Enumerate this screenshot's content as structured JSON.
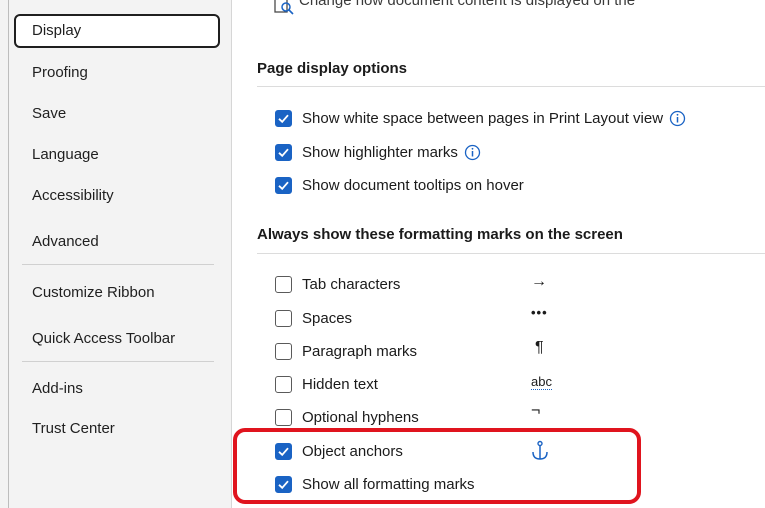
{
  "sidebar": {
    "items": [
      {
        "label": "Display"
      },
      {
        "label": "Proofing"
      },
      {
        "label": "Save"
      },
      {
        "label": "Language"
      },
      {
        "label": "Accessibility"
      },
      {
        "label": "Advanced"
      },
      {
        "label": "Customize Ribbon"
      },
      {
        "label": "Quick Access Toolbar"
      },
      {
        "label": "Add-ins"
      },
      {
        "label": "Trust Center"
      }
    ],
    "selected": "Display"
  },
  "header": {
    "clipped_text": "Change how document content is displayed on the"
  },
  "page_display": {
    "title": "Page display options",
    "options": [
      {
        "label": "Show white space between pages in Print Layout view",
        "checked": true,
        "info": true
      },
      {
        "label": "Show highlighter marks",
        "checked": true,
        "info": true
      },
      {
        "label": "Show document tooltips on hover",
        "checked": true,
        "info": false
      }
    ]
  },
  "formatting_marks": {
    "title": "Always show these formatting marks on the screen",
    "options": [
      {
        "label": "Tab characters",
        "checked": false,
        "symbol": "→"
      },
      {
        "label": "Spaces",
        "checked": false,
        "symbol": "•••"
      },
      {
        "label": "Paragraph marks",
        "checked": false,
        "symbol": "¶"
      },
      {
        "label": "Hidden text",
        "checked": false,
        "symbol": "abc"
      },
      {
        "label": "Optional hyphens",
        "checked": false,
        "symbol": "¬"
      },
      {
        "label": "Object anchors",
        "checked": true,
        "symbol": "anchor-icon"
      },
      {
        "label": "Show all formatting marks",
        "checked": true,
        "symbol": ""
      }
    ]
  },
  "colors": {
    "accent": "#1a63c4",
    "highlight": "#e0141e"
  }
}
